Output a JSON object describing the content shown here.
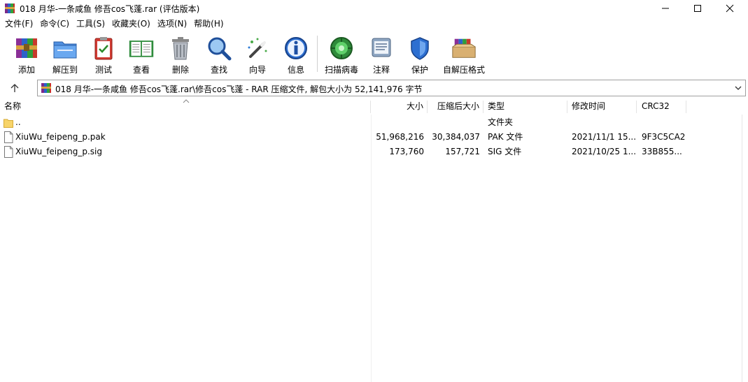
{
  "window": {
    "title": "018 月华-一条咸鱼 修吾cos飞蓬.rar (评估版本)"
  },
  "menu": [
    "文件(F)",
    "命令(C)",
    "工具(S)",
    "收藏夹(O)",
    "选项(N)",
    "帮助(H)"
  ],
  "toolbar": {
    "add": "添加",
    "extract": "解压到",
    "test": "测试",
    "view": "查看",
    "delete": "删除",
    "find": "查找",
    "wizard": "向导",
    "info": "信息",
    "virus_scan": "扫描病毒",
    "comment": "注释",
    "protect": "保护",
    "sfx": "自解压格式"
  },
  "address": {
    "path": "018 月华-一条咸鱼 修吾cos飞蓬.rar\\修吾cos飞蓬 - RAR 压缩文件, 解包大小为 52,141,976 字节"
  },
  "columns": {
    "name": "名称",
    "size": "大小",
    "packed": "压缩后大小",
    "type": "类型",
    "modified": "修改时间",
    "crc": "CRC32"
  },
  "files": [
    {
      "name": "..",
      "size": "",
      "packed": "",
      "type": "文件夹",
      "modified": "",
      "crc": ""
    },
    {
      "name": "XiuWu_feipeng_p.pak",
      "size": "51,968,216",
      "packed": "30,384,037",
      "type": "PAK 文件",
      "modified": "2021/11/1 15...",
      "crc": "9F3C5CA2"
    },
    {
      "name": "XiuWu_feipeng_p.sig",
      "size": "173,760",
      "packed": "157,721",
      "type": "SIG 文件",
      "modified": "2021/10/25 1...",
      "crc": "33B855..."
    }
  ]
}
